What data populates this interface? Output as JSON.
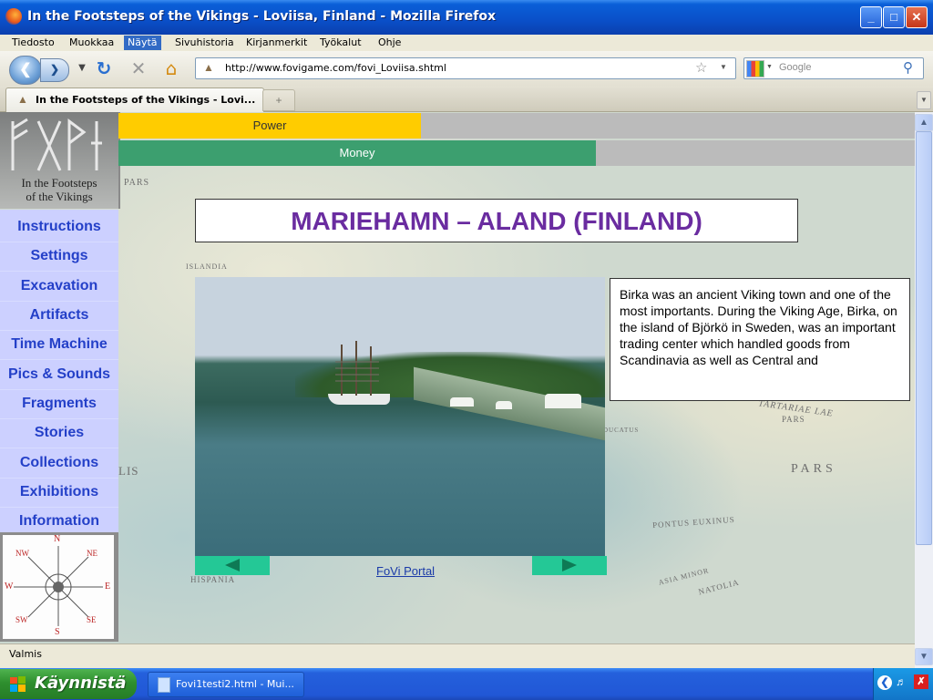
{
  "window": {
    "title": "In the Footsteps of the Vikings - Loviisa, Finland - Mozilla Firefox",
    "minimize": "_",
    "maximize": "□",
    "close": "✕"
  },
  "menubar": [
    "Tiedosto",
    "Muokkaa",
    "Näytä",
    "Sivuhistoria",
    "Kirjanmerkit",
    "Työkalut",
    "Ohje"
  ],
  "navbar": {
    "url": "http://www.fovigame.com/fovi_Loviisa.shtml",
    "search_placeholder": "Google"
  },
  "tabs": [
    {
      "label": "In the Footsteps of the Vikings - Lovi..."
    }
  ],
  "game": {
    "logo_caption_line1": "In the Footsteps",
    "logo_caption_line2": "of the Vikings",
    "menu": [
      "Instructions",
      "Settings",
      "Excavation",
      "Artifacts",
      "Time Machine",
      "Pics & Sounds",
      "Fragments",
      "Stories",
      "Collections",
      "Exhibitions",
      "Information"
    ],
    "power_label": "Power",
    "money_label": "Money",
    "power_level": 0.38,
    "money_level": 0.6,
    "location_title": "MARIEHAMN – ALAND (FINLAND)",
    "description": "Birka was an ancient Viking town and one of the most importants. During the Viking Age, Birka, on the island of Björkö in Sweden, was an important trading center which handled goods from Scandinavia as well as Central and",
    "portal_link": "FoVi Portal",
    "compass": {
      "n": "N",
      "s": "S",
      "w": "W",
      "e": "E",
      "nw": "NW",
      "ne": "NE",
      "sw": "SW",
      "se": "SE"
    },
    "map_labels": [
      "PARS",
      "ISLANDIA",
      "TARTARIAE LAE",
      "PARS",
      "PONTUS EUXINUS",
      "ASIA MINOR",
      "NATOLIA",
      "HISPANIA",
      "LIS",
      "DUCATUS"
    ]
  },
  "status": "Valmis",
  "taskbar": {
    "start_label": "Käynnistä",
    "item_label": "Fovi1testi2.html - Mui..."
  }
}
